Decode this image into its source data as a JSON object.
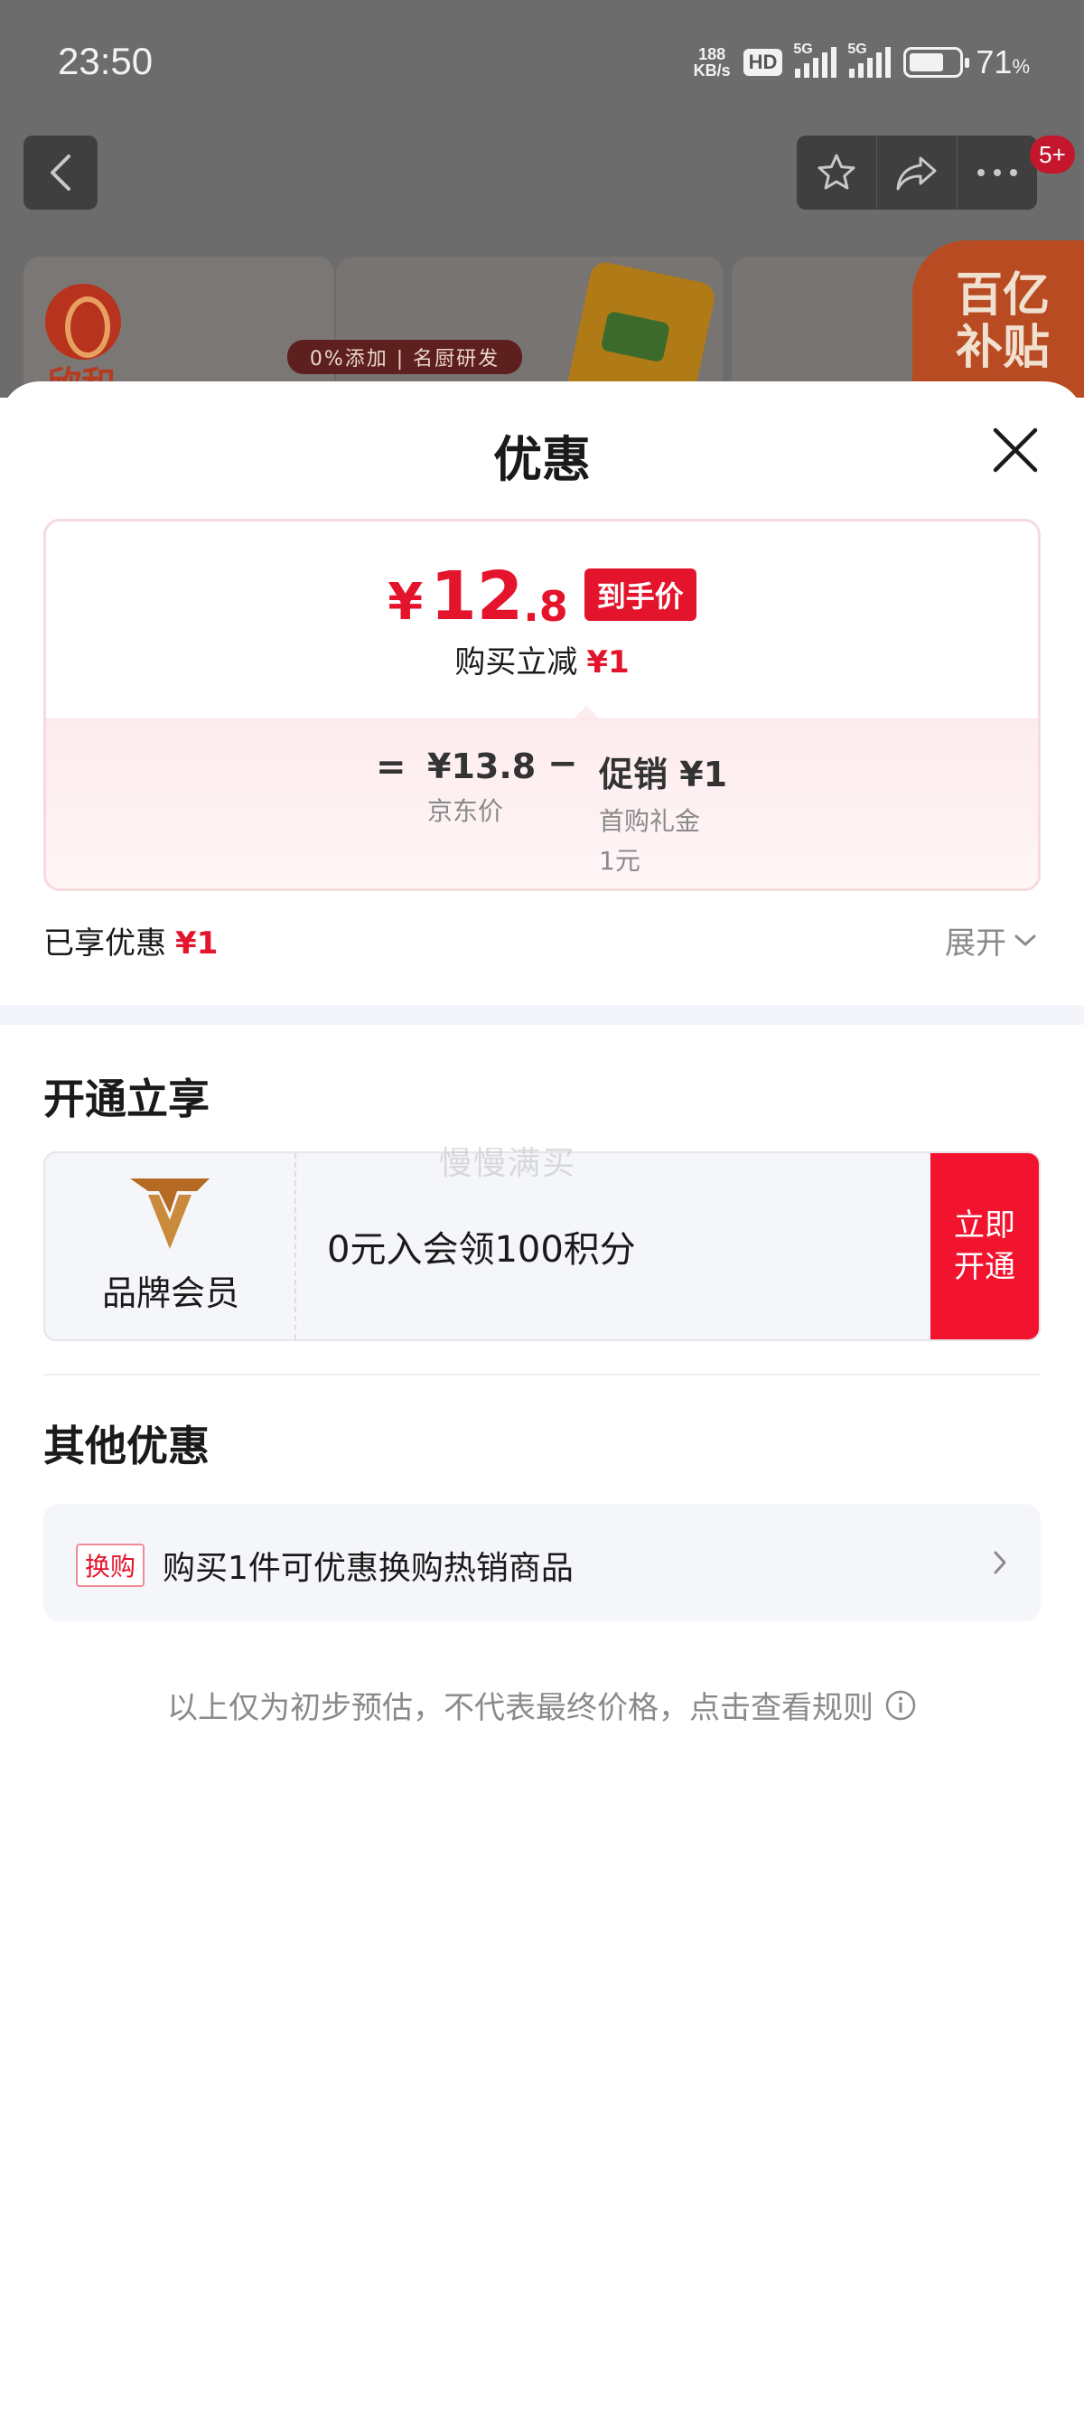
{
  "status_bar": {
    "time": "23:50",
    "net_speed_value": "188",
    "net_speed_unit": "KB/s",
    "hd_badge": "HD",
    "sim1_label": "5G",
    "sim2_label": "5G",
    "battery_percent": 71,
    "battery_text": "71",
    "battery_unit": "%"
  },
  "top_bar": {
    "notification_badge": "5+",
    "icons": [
      "back-icon",
      "star-icon",
      "share-icon",
      "more-icon"
    ]
  },
  "banner": {
    "brand_name": "欣和",
    "slogan": "0%添加 | 名厨研发",
    "subsidy_line1": "百亿",
    "subsidy_line2": "补贴"
  },
  "sheet": {
    "title": "优惠",
    "price_card": {
      "currency": "¥",
      "price_int": "12",
      "price_dec": ".8",
      "price_tag": "到手价",
      "reduce_label": "购买立减",
      "reduce_amount": "¥1",
      "equals": "=",
      "jd_price": "¥13.8",
      "jd_price_label": "京东价",
      "minus": "−",
      "promo_value": "促销 ¥1",
      "promo_sub1": "首购礼金",
      "promo_sub2": "1元"
    },
    "enjoyed_label": "已享优惠",
    "enjoyed_amount": "¥1",
    "expand_label": "展开",
    "open_section": {
      "title": "开通立享",
      "member_label": "品牌会员",
      "member_text": "0元入会领100积分",
      "open_button": "立即开通",
      "watermark": "慢慢满买"
    },
    "other_section": {
      "title": "其他优惠",
      "badge": "换购",
      "text": "购买1件可优惠换购热销商品"
    },
    "disclaimer": "以上仅为初步预估，不代表最终价格，点击查看规则"
  },
  "colors": {
    "accent_red": "#e4142c",
    "button_red": "#f2142f",
    "gold": "#a8621e"
  }
}
